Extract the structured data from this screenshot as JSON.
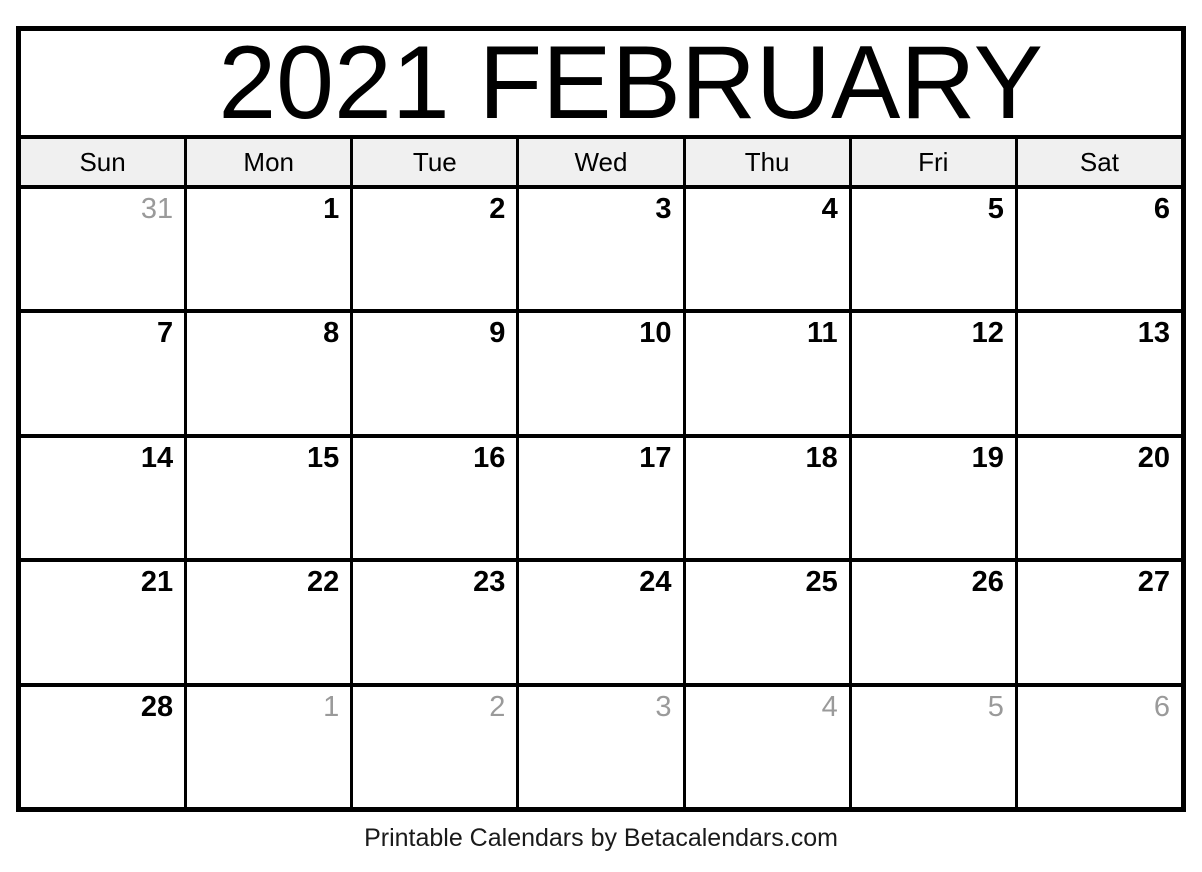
{
  "calendar": {
    "year": "2021",
    "month": "FEBRUARY",
    "title": "2021 FEBRUARY",
    "weekday_headers": [
      "Sun",
      "Mon",
      "Tue",
      "Wed",
      "Thu",
      "Fri",
      "Sat"
    ],
    "weeks": [
      [
        {
          "num": "31",
          "in_month": false
        },
        {
          "num": "1",
          "in_month": true
        },
        {
          "num": "2",
          "in_month": true
        },
        {
          "num": "3",
          "in_month": true
        },
        {
          "num": "4",
          "in_month": true
        },
        {
          "num": "5",
          "in_month": true
        },
        {
          "num": "6",
          "in_month": true
        }
      ],
      [
        {
          "num": "7",
          "in_month": true
        },
        {
          "num": "8",
          "in_month": true
        },
        {
          "num": "9",
          "in_month": true
        },
        {
          "num": "10",
          "in_month": true
        },
        {
          "num": "11",
          "in_month": true
        },
        {
          "num": "12",
          "in_month": true
        },
        {
          "num": "13",
          "in_month": true
        }
      ],
      [
        {
          "num": "14",
          "in_month": true
        },
        {
          "num": "15",
          "in_month": true
        },
        {
          "num": "16",
          "in_month": true
        },
        {
          "num": "17",
          "in_month": true
        },
        {
          "num": "18",
          "in_month": true
        },
        {
          "num": "19",
          "in_month": true
        },
        {
          "num": "20",
          "in_month": true
        }
      ],
      [
        {
          "num": "21",
          "in_month": true
        },
        {
          "num": "22",
          "in_month": true
        },
        {
          "num": "23",
          "in_month": true
        },
        {
          "num": "24",
          "in_month": true
        },
        {
          "num": "25",
          "in_month": true
        },
        {
          "num": "26",
          "in_month": true
        },
        {
          "num": "27",
          "in_month": true
        }
      ],
      [
        {
          "num": "28",
          "in_month": true
        },
        {
          "num": "1",
          "in_month": false
        },
        {
          "num": "2",
          "in_month": false
        },
        {
          "num": "3",
          "in_month": false
        },
        {
          "num": "4",
          "in_month": false
        },
        {
          "num": "5",
          "in_month": false
        },
        {
          "num": "6",
          "in_month": false
        }
      ]
    ],
    "colors": {
      "in_month_text": "#000000",
      "other_month_text": "#9a9a9a",
      "header_background": "#f0f0f0",
      "grid_line": "#000000",
      "page_background": "#ffffff"
    }
  },
  "footer": {
    "credit": "Printable Calendars by Betacalendars.com"
  }
}
